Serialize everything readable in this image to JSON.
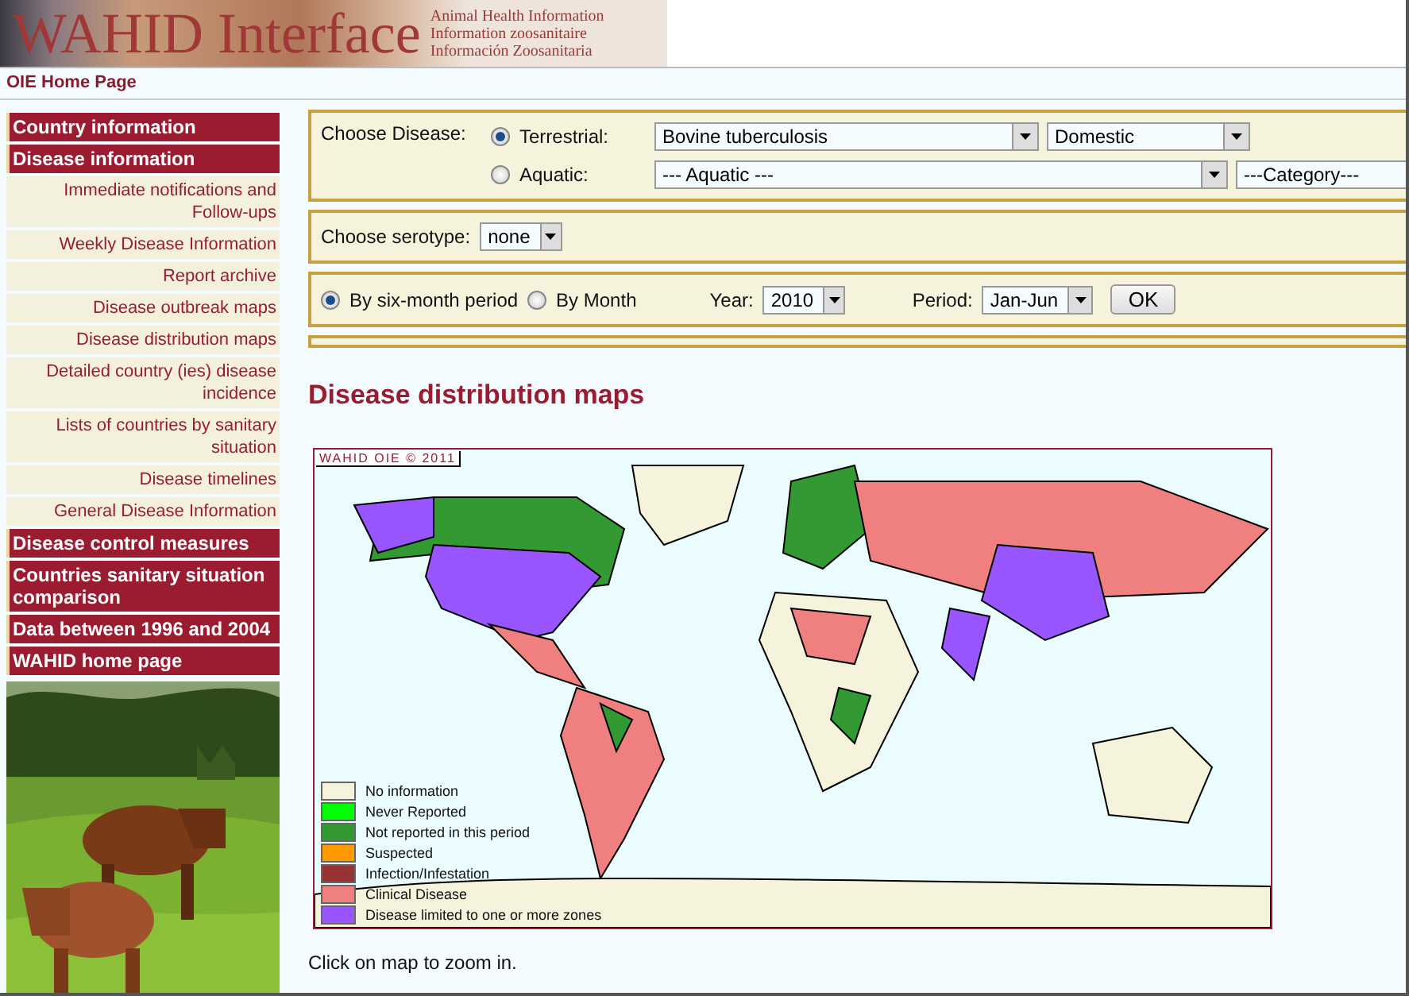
{
  "header": {
    "title": "WAHID Interface",
    "subtitles": [
      "Animal Health Information",
      "Information zoosanitaire",
      "Información Zoosanitaria"
    ]
  },
  "top_link": "OIE Home Page",
  "sidebar": {
    "items": [
      {
        "kind": "section",
        "label": "Country information"
      },
      {
        "kind": "section",
        "label": "Disease information"
      },
      {
        "kind": "link",
        "label": "Immediate notifications and Follow-ups"
      },
      {
        "kind": "link",
        "label": "Weekly Disease Information"
      },
      {
        "kind": "link",
        "label": "Report archive"
      },
      {
        "kind": "link",
        "label": "Disease outbreak maps"
      },
      {
        "kind": "link",
        "label": "Disease distribution maps"
      },
      {
        "kind": "link",
        "label": "Detailed country (ies) disease incidence"
      },
      {
        "kind": "link",
        "label": "Lists of countries by sanitary situation"
      },
      {
        "kind": "link",
        "label": "Disease timelines"
      },
      {
        "kind": "link",
        "label": "General Disease Information"
      },
      {
        "kind": "section",
        "label": "Disease control measures"
      },
      {
        "kind": "section",
        "label": "Countries sanitary situation comparison"
      },
      {
        "kind": "section",
        "label": "Data between 1996 and 2004"
      },
      {
        "kind": "section",
        "label": "WAHID home page"
      }
    ]
  },
  "disease": {
    "label": "Choose Disease:",
    "options": [
      {
        "label": "Terrestrial:",
        "selected": true,
        "disease": "Bovine tuberculosis",
        "category": "Domestic"
      },
      {
        "label": "Aquatic:",
        "selected": false,
        "disease": "--- Aquatic ---",
        "category": "---Category---"
      }
    ]
  },
  "serotype": {
    "label": "Choose serotype:",
    "value": "none"
  },
  "period": {
    "modes": [
      {
        "label": "By six-month period",
        "selected": true
      },
      {
        "label": "By Month",
        "selected": false
      }
    ],
    "year_label": "Year:",
    "year": "2010",
    "period_label": "Period:",
    "period": "Jan-Jun",
    "ok": "OK"
  },
  "map": {
    "title": "Disease distribution maps",
    "copyright": "WAHID OIE © 2011",
    "legend": [
      {
        "label": "No information",
        "color": "#f5f3dc"
      },
      {
        "label": "Never Reported",
        "color": "#00ff00"
      },
      {
        "label": "Not reported in this period",
        "color": "#339933"
      },
      {
        "label": "Suspected",
        "color": "#ff9900"
      },
      {
        "label": "Infection/Infestation",
        "color": "#993333"
      },
      {
        "label": "Clinical Disease",
        "color": "#f08080"
      },
      {
        "label": "Disease limited to one or more zones",
        "color": "#9955ff"
      }
    ],
    "hint": "Click on map to zoom in."
  }
}
